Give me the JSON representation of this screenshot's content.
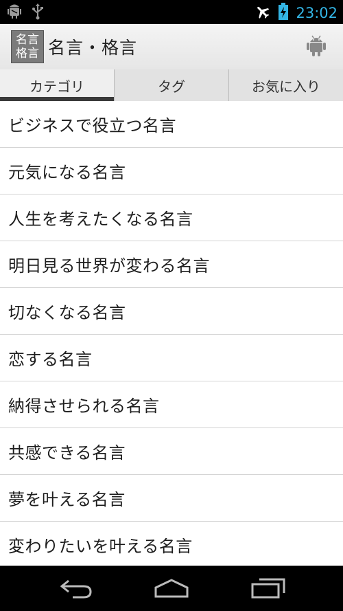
{
  "statusbar": {
    "time": "23:02",
    "left_icons": [
      "android-debug-icon",
      "usb-icon"
    ],
    "right_icons": [
      "airplane-mode-icon",
      "battery-charging-icon"
    ]
  },
  "actionbar": {
    "app_icon_text_top": "名言",
    "app_icon_text_bottom": "格言",
    "title": "名言・格言",
    "action_icon": "android-icon"
  },
  "tabs": [
    {
      "label": "カテゴリ",
      "active": true
    },
    {
      "label": "タグ",
      "active": false
    },
    {
      "label": "お気に入り",
      "active": false
    }
  ],
  "list": {
    "items": [
      "ビジネスで役立つ名言",
      "元気になる名言",
      "人生を考えたくなる名言",
      "明日見る世界が変わる名言",
      "切なくなる名言",
      "恋する名言",
      "納得させられる名言",
      "共感できる名言",
      "夢を叶える名言",
      "変わりたいを叶える名言"
    ]
  },
  "navbar": {
    "buttons": [
      "back-icon",
      "home-icon",
      "recent-apps-icon"
    ]
  },
  "colors": {
    "accent": "#33b5e5",
    "actionbar": "#ececec",
    "tab_indicator": "#3a3a3a"
  }
}
